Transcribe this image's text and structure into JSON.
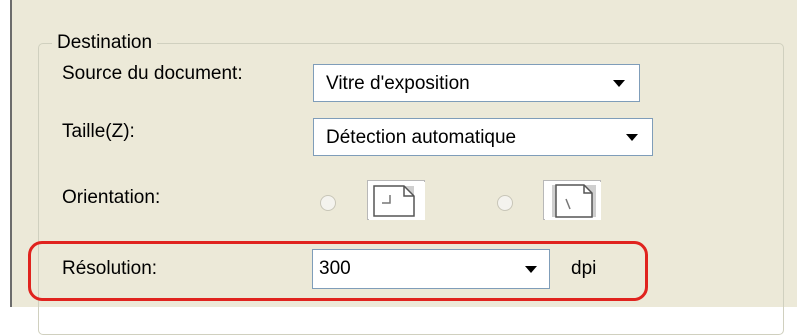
{
  "group": {
    "title": "Destination"
  },
  "source": {
    "label": "Source du document:",
    "value": "Vitre d'exposition"
  },
  "size": {
    "label": "Taille(Z):",
    "value": "Détection automatique"
  },
  "orientation": {
    "label": "Orientation:",
    "portrait_icon": "portrait-orientation-icon",
    "landscape_icon": "landscape-orientation-icon"
  },
  "resolution": {
    "label": "Résolution:",
    "value": "300",
    "unit": "dpi",
    "highlight_color": "#e0231e"
  },
  "colors": {
    "background": "#ece9d8",
    "combo_border": "#7f9db9"
  }
}
